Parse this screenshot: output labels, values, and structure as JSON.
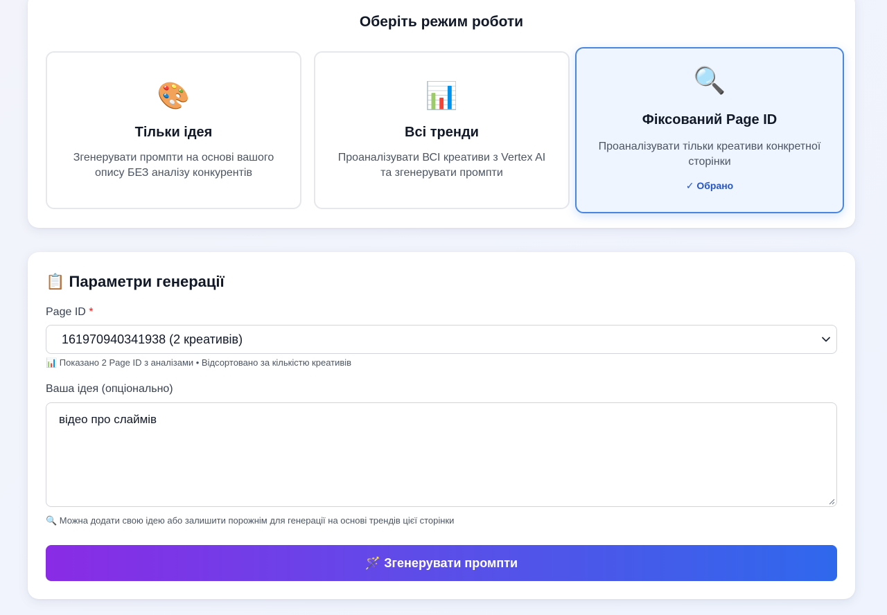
{
  "mode_selector": {
    "title": "Оберіть режим роботи",
    "options": [
      {
        "icon": "🎨",
        "icon_name": "palette-icon",
        "name": "Тільки ідея",
        "description": "Згенерувати промпти на основі вашого опису БЕЗ аналізу конкурентів"
      },
      {
        "icon": "📊",
        "icon_name": "bar-chart-icon",
        "name": "Всі тренди",
        "description": "Проаналізувати ВСІ креативи з Vertex AI та згенерувати промпти"
      },
      {
        "icon": "🔍",
        "icon_name": "magnifier-icon",
        "name": "Фіксований Page ID",
        "description": "Проаналізувати тільки креативи конкретної сторінки",
        "selected_label": "✓ Обрано"
      }
    ],
    "selected_index": 2
  },
  "params": {
    "title": "📋 Параметри генерації",
    "page_id": {
      "label": "Page ID",
      "required_mark": "*",
      "selected_value": "161970940341938 (2 креативів)",
      "hint": "📊 Показано 2 Page ID з аналізами • Відсортовано за кількістю креативів"
    },
    "idea": {
      "label": "Ваша ідея (опціонально)",
      "value": "відео про слаймів",
      "hint": "🔍 Можна додати свою ідею або залишити порожнім для генерації на основі трендів цієї сторінки"
    },
    "generate_button_label": "🪄 Згенерувати промпти"
  },
  "colors": {
    "accent": "#3b82f6",
    "selected_border": "#4a86e0",
    "selected_bg": "#eef5fe",
    "button_gradient_start": "#8a2be6",
    "button_gradient_end": "#2f68ec",
    "required": "#dc2626"
  }
}
